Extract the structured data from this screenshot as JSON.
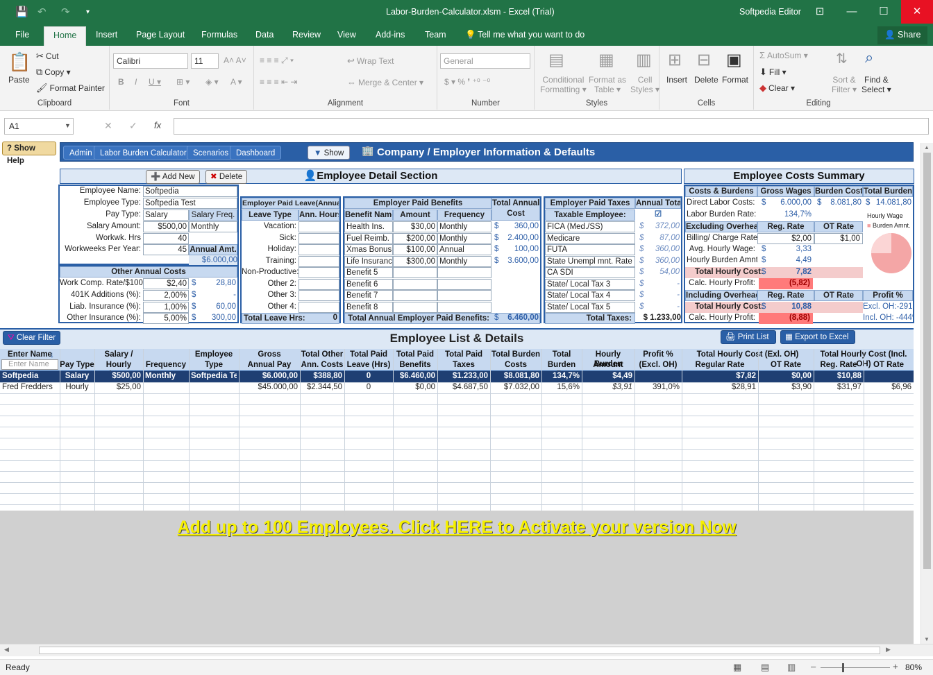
{
  "title": {
    "filename": "Labor-Burden-Calculator.xlsm - Excel (Trial)",
    "user": "Softpedia Editor"
  },
  "tabs": [
    "File",
    "Home",
    "Insert",
    "Page Layout",
    "Formulas",
    "Data",
    "Review",
    "View",
    "Add-ins",
    "Team"
  ],
  "tellme": "Tell me what you want to do",
  "share": "Share",
  "ribbon": {
    "paste": "Paste",
    "cut": "Cut",
    "copy": "Copy",
    "format_painter": "Format Painter",
    "clipboard": "Clipboard",
    "font_name": "Calibri",
    "font_size": "11",
    "font": "Font",
    "wrap": "Wrap Text",
    "merge": "Merge & Center",
    "alignment": "Alignment",
    "numfmt": "General",
    "number": "Number",
    "cond": "Conditional",
    "cond2": "Formatting",
    "fmt_table": "Format as",
    "fmt_table2": "Table",
    "cell_styles": "Cell",
    "cell_styles2": "Styles",
    "styles": "Styles",
    "insert": "Insert",
    "delete": "Delete",
    "format": "Format",
    "cells": "Cells",
    "autosum": "AutoSum",
    "fill": "Fill",
    "clear": "Clear",
    "sort": "Sort &",
    "sort2": "Filter",
    "find": "Find &",
    "find2": "Select",
    "editing": "Editing"
  },
  "namebox": "A1",
  "nav": {
    "show_help": "Show Help",
    "admin": "Admin",
    "calc": "Labor Burden Calculator",
    "scenarios": "Scenarios",
    "dashboard": "Dashboard",
    "show": "Show",
    "company": "Company / Employer Information & Defaults"
  },
  "detail": {
    "add": "Add New",
    "del": "Delete",
    "header": "Employee Detail Section",
    "emp_name_l": "Employee Name:",
    "emp_name": "Softpedia",
    "emp_type_l": "Employee Type:",
    "emp_type": "Softpedia Test",
    "pay_type_l": "Pay Type:",
    "pay_type": "Salary",
    "sal_freq_l": "Salary Freq.",
    "sal_amt_l": "Salary Amount:",
    "sal_amt": "$500,00",
    "sal_freq": "Monthly",
    "ww_hrs_l": "Workwk. Hrs",
    "ww_hrs": "40",
    "ww_yr_l": "Workweeks Per Year:",
    "ww_yr": "45",
    "annual_amt_l": "Annual Amt.",
    "annual_amt": "$6.000,00",
    "other_hdr": "Other  Annual Costs",
    "wc_l": "Work Comp. Rate/$100:",
    "wc": "$2,40",
    "wc_v": "28,80",
    "k401_l": "401K Additions (%):",
    "k401": "2,00%",
    "k401_v": "-",
    "liab_l": "Liab. Insurance (%):",
    "liab": "1,00%",
    "liab_v": "60,00",
    "oth_l": "Other Insurance (%):",
    "oth": "5,00%",
    "oth_v": "300,00",
    "dollar": "$"
  },
  "leave": {
    "hdr": "Employer Paid Leave(Annual)",
    "type": "Leave Type",
    "hours": "Ann. Hours",
    "items": [
      "Vacation:",
      "Sick:",
      "Holiday:",
      "Training:",
      "Non-Productive:",
      "Other 2:",
      "Other 3:",
      "Other 4:"
    ],
    "total_l": "Total Leave Hrs:",
    "total": "0"
  },
  "benefits": {
    "hdr": "Employer Paid Benefits",
    "tac": "Total Annual",
    "tac2": "Cost",
    "name": "Benefit Name",
    "amount": "Amount",
    "freq": "Frequency",
    "items": [
      [
        "Health Ins.",
        "$30,00",
        "Monthly",
        "360,00"
      ],
      [
        "Fuel Reimb.",
        "$200,00",
        "Monthly",
        "2.400,00"
      ],
      [
        "Xmas Bonus",
        "$100,00",
        "Annual",
        "100,00"
      ],
      [
        "Life Insurance",
        "$300,00",
        "Monthly",
        "3.600,00"
      ],
      [
        "Benefit 5",
        "",
        "",
        ""
      ],
      [
        "Benefit 6",
        "",
        "",
        ""
      ],
      [
        "Benefit 7",
        "",
        "",
        ""
      ],
      [
        "Benefit 8",
        "",
        "",
        ""
      ]
    ],
    "total_l": "Total Annual Employer Paid Benefits:",
    "total": "6.460,00"
  },
  "taxes": {
    "hdr": "Employer Paid Taxes",
    "tot": "Annual Total",
    "taxable": "Taxable Employee:",
    "items": [
      [
        "FICA (Med./SS)",
        "372,00"
      ],
      [
        "Medicare",
        "87,00"
      ],
      [
        "FUTA",
        "360,00"
      ],
      [
        "State Unempl mnt. Rate",
        "360,00"
      ],
      [
        "CA SDI",
        "54,00"
      ],
      [
        "State/ Local Tax 3",
        "-"
      ],
      [
        "State/ Local Tax 4",
        "-"
      ],
      [
        "State/ Local Tax 5",
        "-"
      ]
    ],
    "total_l": "Total Taxes:",
    "total": "$ 1.233,00"
  },
  "summary": {
    "hdr": "Employee Costs Summary",
    "cb": "Costs & Burdens",
    "gw": "Gross Wages",
    "bc": "Burden Costs",
    "tb": "Total Burden",
    "dlc_l": "Direct Labor Costs:",
    "dlc_gw": "6.000,00",
    "dlc_bc": "8.081,80",
    "dlc_tb": "14.081,80",
    "lbr_l": "Labor Burden Rate:",
    "lbr": "134,7%",
    "exoh": "Excluding Overhead",
    "reg": "Reg. Rate",
    "ot": "OT Rate",
    "bill_l": "Billing/ Charge Rate:",
    "bill": "$2,00",
    "bill_ot": "$1,00",
    "ahw_l": "Avg. Hourly Wage:",
    "ahw": "3,33",
    "hba_l": "Hourly Burden Amnt.:",
    "hba": "4,49",
    "thc_l": "Total Hourly Cost:",
    "thc": "7,82",
    "chp_l": "Calc. Hourly Profit:",
    "chp": "(5,82)",
    "inoh": "Including Overhead",
    "profit": "Profit %",
    "thc2": "10,88",
    "excl": "Excl. OH:-291%",
    "chp2": "(8,88)",
    "incl": "Incl. OH: -444%",
    "leg1": "Hourly Wage",
    "leg2": "Burden Amnt."
  },
  "list": {
    "clear": "Clear Filter",
    "hdr": "Employee List & Details",
    "print": "Print List",
    "export": "Export to Excel",
    "cols": [
      [
        "Enter Name",
        ""
      ],
      [
        "",
        "Pay Type"
      ],
      [
        "Salary /",
        "Hourly Amnt."
      ],
      [
        "",
        "Frequency"
      ],
      [
        "Employee",
        "Type"
      ],
      [
        "Gross",
        "Annual Pay"
      ],
      [
        "Total Other",
        "Ann. Costs"
      ],
      [
        "Total Paid",
        "Leave (Hrs)"
      ],
      [
        "Total Paid",
        "Benefits"
      ],
      [
        "Total Paid",
        "Taxes"
      ],
      [
        "Total Burden",
        "Costs"
      ],
      [
        "Total",
        "Burden Rt."
      ],
      [
        "Hourly Burden",
        "Amount"
      ],
      [
        "Profit %",
        "(Excl. OH)"
      ],
      [
        "",
        "Regular Rate"
      ],
      [
        "",
        "OT Rate"
      ],
      [
        "",
        "Reg. Rate"
      ],
      [
        "",
        "OT Rate"
      ]
    ],
    "grp1": "Total Hourly Cost (Exl. OH)",
    "grp2": "Total Hourly Cost (Incl. OH)",
    "filter_ph": "Enter Name",
    "rows": [
      [
        "Softpedia",
        "Salary",
        "$500,00",
        "Monthly",
        "Softpedia Test",
        "$6.000,00",
        "$388,80",
        "0",
        "$6.460,00",
        "$1.233,00",
        "$8.081,80",
        "134,7%",
        "$4,49",
        "",
        "$7,82",
        "$0,00",
        "$10,88",
        ""
      ],
      [
        "Fred Fredders",
        "Hourly",
        "$25,00",
        "",
        "",
        "$45.000,00",
        "$2.344,50",
        "0",
        "$0,00",
        "$4.687,50",
        "$7.032,00",
        "15,6%",
        "$3,91",
        "391,0%",
        "$28,91",
        "$3,90",
        "$31,97",
        "$6,96"
      ]
    ],
    "activate": "Add up to 100 Employees. Click HERE to Activate your version Now"
  },
  "status": {
    "ready": "Ready",
    "zoom": "80%"
  }
}
